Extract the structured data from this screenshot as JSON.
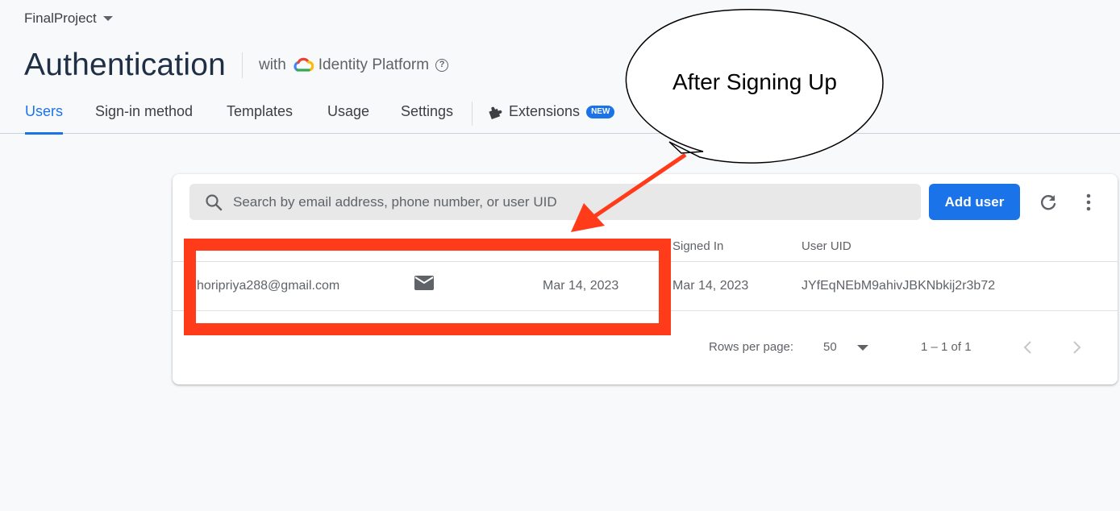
{
  "project": {
    "name": "FinalProject"
  },
  "header": {
    "title": "Authentication",
    "with_label": "with",
    "platform_label": "Identity Platform",
    "help_icon": "help-circle-icon"
  },
  "tabs": [
    {
      "label": "Users",
      "active": true
    },
    {
      "label": "Sign-in method",
      "active": false
    },
    {
      "label": "Templates",
      "active": false
    },
    {
      "label": "Usage",
      "active": false
    },
    {
      "label": "Settings",
      "active": false
    },
    {
      "label": "Extensions",
      "active": false,
      "badge": "NEW",
      "icon": "puzzle-icon"
    }
  ],
  "toolbar": {
    "search_placeholder": "Search by email address, phone number, or user UID",
    "add_user_label": "Add user"
  },
  "table": {
    "columns": [
      "Signed In",
      "User UID"
    ],
    "rows": [
      {
        "identifier": "horipriya288@gmail.com",
        "provider_icon": "mail-icon",
        "created": "Mar 14, 2023",
        "signed_in": "Mar 14, 2023",
        "user_uid": "JYfEqNEbM9ahivJBKNbkij2r3b72"
      }
    ]
  },
  "pagination": {
    "rows_per_page_label": "Rows per page:",
    "rows_per_page_value": "50",
    "range_label": "1 – 1 of 1"
  },
  "annotation": {
    "bubble_text": "After Signing Up"
  },
  "colors": {
    "accent": "#1a73e8",
    "annotation_red": "#ff3b1a"
  }
}
